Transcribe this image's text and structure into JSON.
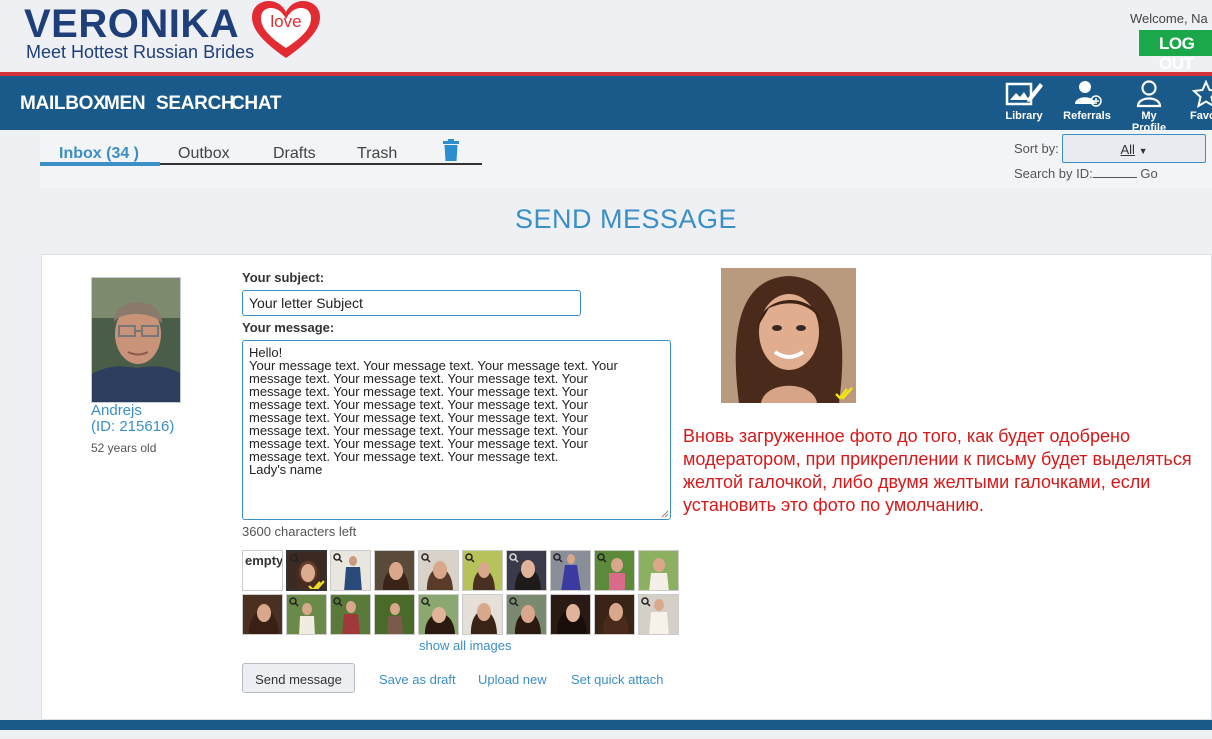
{
  "header": {
    "logo_word": "VERONIKA",
    "logo_badge": "love",
    "logo_tagline": "Meet Hottest Russian Brides",
    "welcome": "Welcome, Na",
    "logout_label": "LOG OUT"
  },
  "nav": {
    "items": [
      "MAILBOX",
      "MEN",
      "SEARCH",
      "CHAT"
    ],
    "icons": [
      {
        "label": "Library",
        "icon": "library-icon"
      },
      {
        "label": "Referrals",
        "icon": "referrals-icon"
      },
      {
        "label": "My Profile",
        "icon": "profile-icon"
      },
      {
        "label": "Favo",
        "icon": "star-icon"
      }
    ]
  },
  "mailbox": {
    "tabs": [
      "Inbox (34 )",
      "Outbox",
      "Drafts",
      "Trash"
    ],
    "active_tab": "Inbox (34 )",
    "sort_label": "Sort by:",
    "sort_value": "All",
    "search_label": "Search by ID:",
    "go_label": "Go"
  },
  "page": {
    "heading": "SEND MESSAGE"
  },
  "recipient": {
    "name": "Andrejs",
    "id_text": "(ID: 215616)",
    "age": "52 years old"
  },
  "form": {
    "subject_label": "Your subject:",
    "subject_value": "Your letter Subject",
    "message_label": "Your message:",
    "message_value": "Hello!\nYour message text. Your message text. Your message text. Your\nmessage text. Your message text. Your message text. Your\nmessage text. Your message text. Your message text. Your\nmessage text. Your message text. Your message text. Your\nmessage text. Your message text. Your message text. Your\nmessage text. Your message text. Your message text. Your\nmessage text. Your message text. Your message text. Your\nmessage text. Your message text. Your message text.\nLady's name",
    "chars_left": "3600 characters left",
    "empty_label": "empty",
    "show_all": "show all images",
    "send_label": "Send message",
    "save_draft_label": "Save as draft",
    "upload_label": "Upload new",
    "quick_attach_label": "Set quick attach"
  },
  "note": "Вновь загруженное фото до того, как будет одобрено модератором, при прикреплении к письму будет выделяться желтой галочкой, либо двумя желтыми галочками, если установить это фото по умолчанию.",
  "colors": {
    "brand_blue": "#1a5a8a",
    "accent": "#3a8fc7",
    "logout_green": "#1aa84a",
    "note_red": "#d81818",
    "check_yellow": "#f2e21b"
  }
}
